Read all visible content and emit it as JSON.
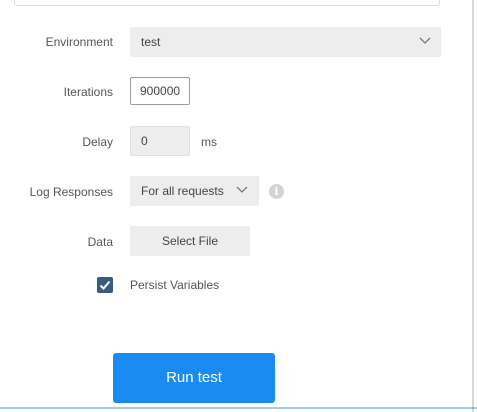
{
  "form": {
    "environment": {
      "label": "Environment",
      "value": "test"
    },
    "iterations": {
      "label": "Iterations",
      "value": "900000"
    },
    "delay": {
      "label": "Delay",
      "value": "0",
      "unit": "ms"
    },
    "log_responses": {
      "label": "Log Responses",
      "value": "For all requests",
      "info_icon": "info-icon"
    },
    "data": {
      "label": "Data",
      "button_label": "Select File"
    },
    "persist_variables": {
      "label": "Persist Variables",
      "checked": true
    }
  },
  "actions": {
    "run_label": "Run test"
  },
  "colors": {
    "primary": "#1a8bf0",
    "checkbox": "#3a5b80",
    "field_bg": "#ededed"
  }
}
